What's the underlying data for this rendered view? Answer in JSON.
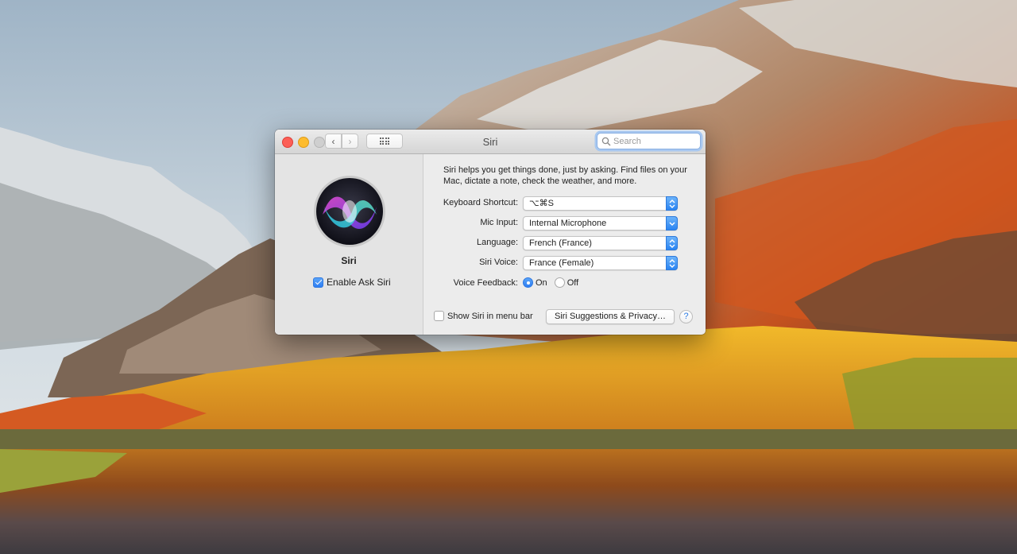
{
  "window": {
    "title": "Siri",
    "search_placeholder": "Search"
  },
  "left_pane": {
    "app_name": "Siri",
    "enable_label": "Enable Ask Siri",
    "enable_checked": true
  },
  "description": "Siri helps you get things done, just by asking. Find files on your Mac, dictate a note, check the weather, and more.",
  "settings": {
    "keyboard_shortcut": {
      "label": "Keyboard Shortcut:",
      "value": "⌥⌘S"
    },
    "mic_input": {
      "label": "Mic Input:",
      "value": "Internal Microphone"
    },
    "language": {
      "label": "Language:",
      "value": "French (France)"
    },
    "siri_voice": {
      "label": "Siri Voice:",
      "value": "France (Female)"
    },
    "voice_feedback": {
      "label": "Voice Feedback:",
      "on_label": "On",
      "off_label": "Off",
      "selected": "On"
    }
  },
  "footer": {
    "menubar_label": "Show Siri in menu bar",
    "menubar_checked": false,
    "suggestions_button": "Siri Suggestions & Privacy…",
    "help_label": "?"
  },
  "colors": {
    "accent": "#2e7ef3",
    "close": "#fc5f57",
    "minimize": "#fdbc2e"
  }
}
